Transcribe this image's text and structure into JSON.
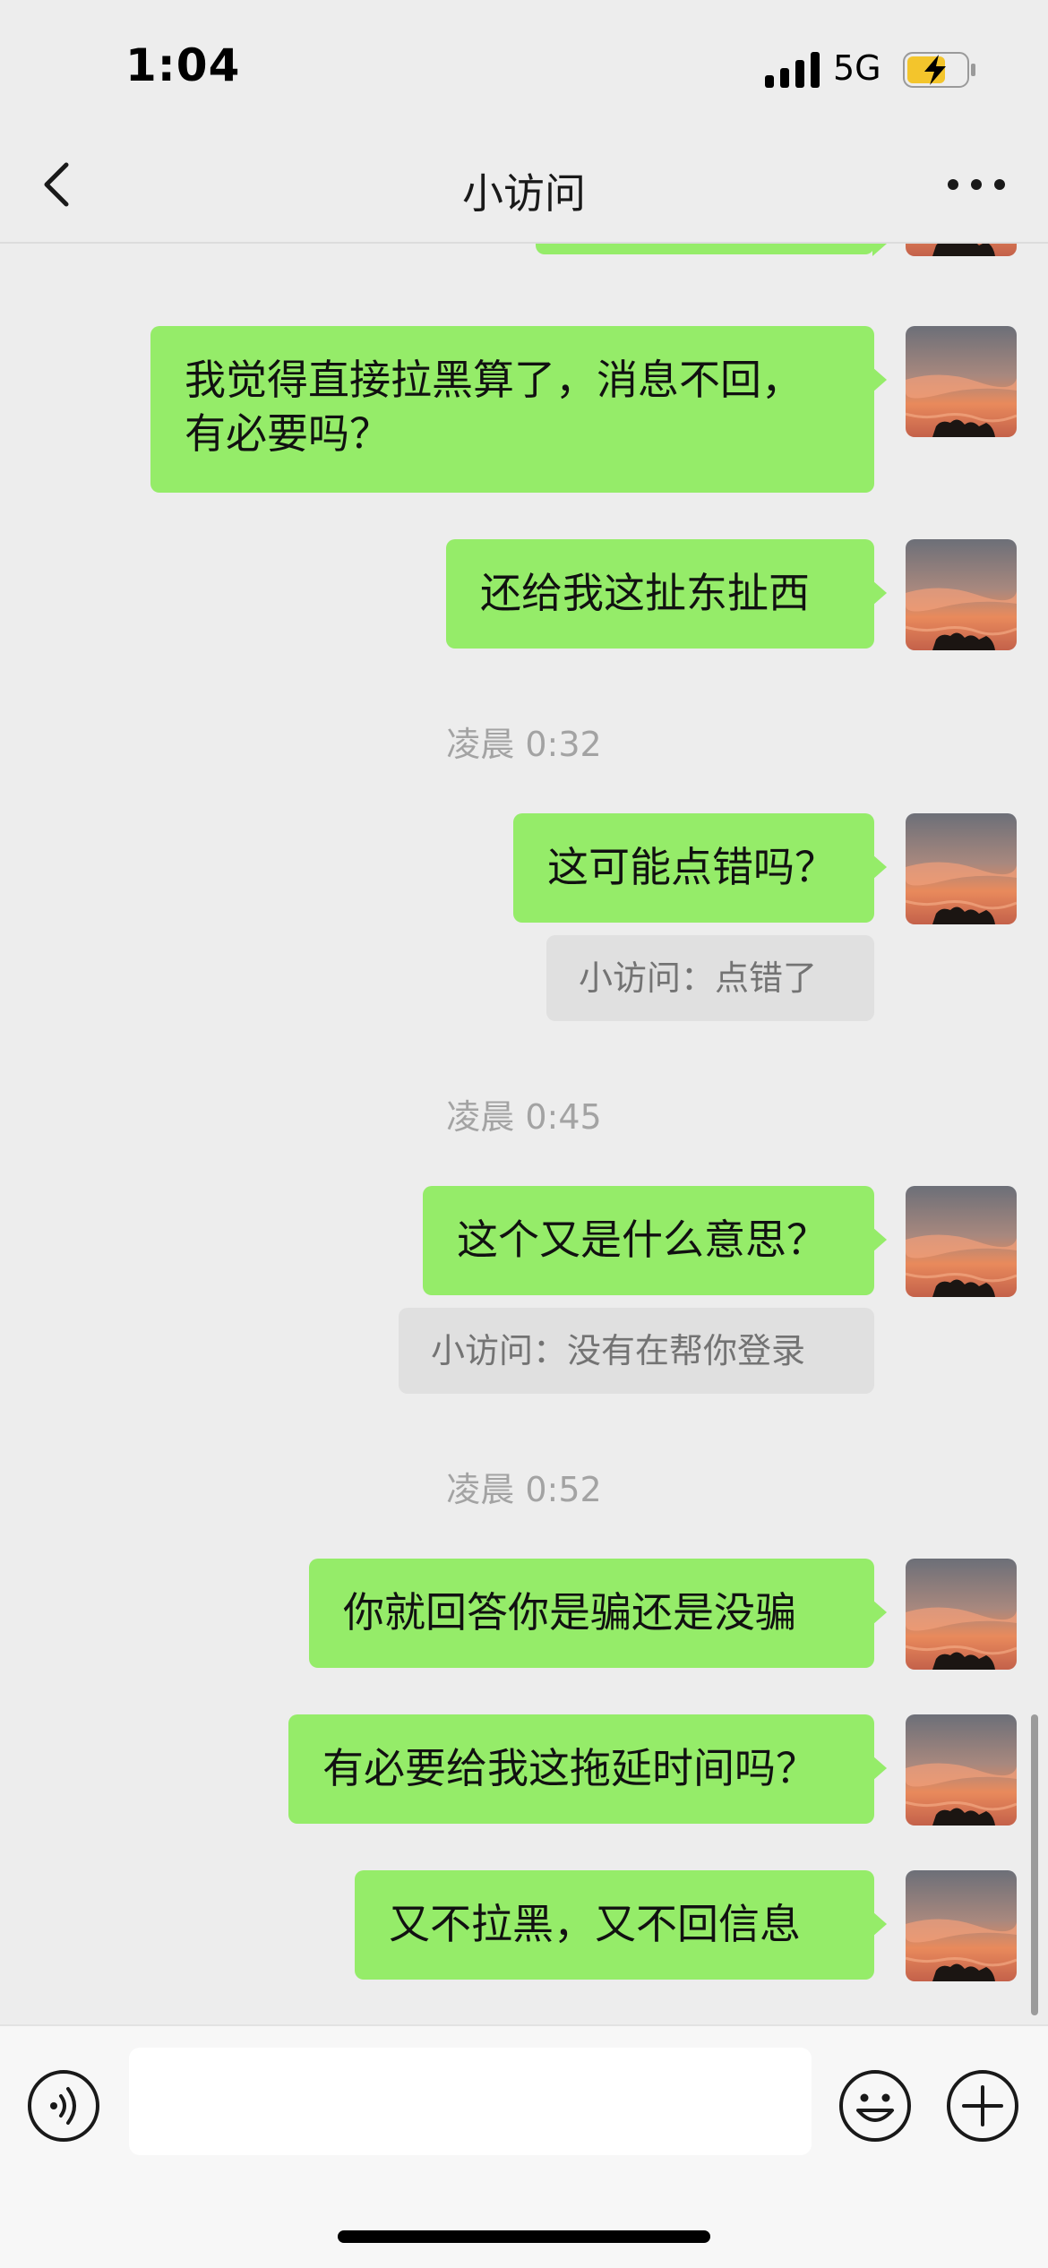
{
  "status_bar": {
    "time": "1:04",
    "network": "5G",
    "battery_icon": "battery-charging-icon",
    "signal_icon": "signal-bars-icon"
  },
  "nav": {
    "title": "小访问",
    "back_icon": "chevron-left-icon",
    "more_icon": "more-dots-icon"
  },
  "messages": [
    {
      "text": "我觉得直接拉黑算了，消息不回，",
      "text2": "有必要吗？"
    },
    {
      "text": "还给我这扯东扯西"
    },
    {
      "text": "这可能点错吗？"
    },
    {
      "text": "这个又是什么意思？"
    },
    {
      "text": "你就回答你是骗还是没骗"
    },
    {
      "text": "有必要给我这拖延时间吗？"
    },
    {
      "text": "又不拉黑，又不回信息"
    }
  ],
  "timestamps": [
    "凌晨 0:32",
    "凌晨 0:45",
    "凌晨 0:52"
  ],
  "quotes": [
    "小访问：点错了",
    "小访问：没有在帮你登录"
  ],
  "colors": {
    "bubble": "#95ec69",
    "background": "#ededed",
    "timestamp": "#a3a3a3"
  },
  "input_bar": {
    "voice_icon": "voice-icon",
    "emoji_icon": "emoji-icon",
    "plus_icon": "plus-circle-icon",
    "placeholder": ""
  }
}
